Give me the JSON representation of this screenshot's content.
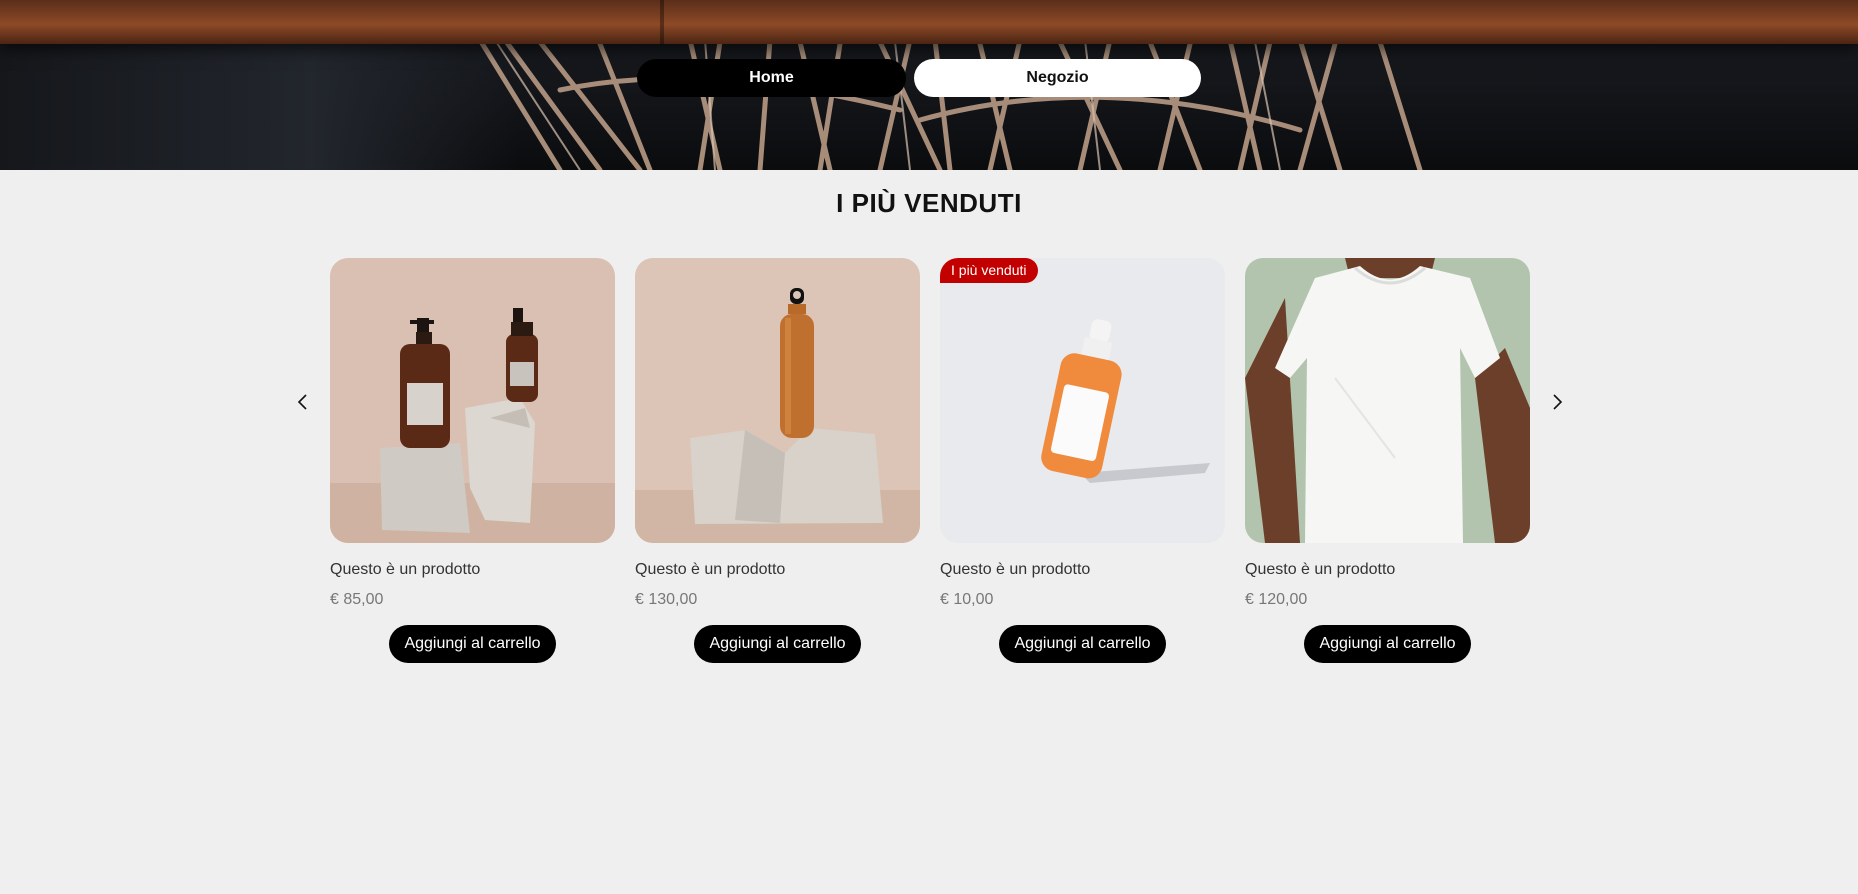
{
  "nav": {
    "home_label": "Home",
    "shop_label": "Negozio"
  },
  "section": {
    "title": "I PIÙ VENDUTI"
  },
  "carousel": {
    "prev_icon": "chevron-left-icon",
    "next_icon": "chevron-right-icon",
    "products": [
      {
        "name": "Questo è un prodotto",
        "price": "€ 85,00",
        "button": "Aggiungi al carrello",
        "badge": "",
        "image": "amber-pump-bottles-on-stone"
      },
      {
        "name": "Questo è un prodotto",
        "price": "€ 130,00",
        "button": "Aggiungi al carrello",
        "badge": "",
        "image": "copper-water-bottle-on-stone"
      },
      {
        "name": "Questo è un prodotto",
        "price": "€ 10,00",
        "button": "Aggiungi al carrello",
        "badge": "I più venduti",
        "image": "orange-dropper-bottle"
      },
      {
        "name": "Questo è un prodotto",
        "price": "€ 120,00",
        "button": "Aggiungi al carrello",
        "badge": "",
        "image": "white-t-shirt-model"
      }
    ]
  },
  "colors": {
    "background": "#efefef",
    "badge": "#c30000",
    "button": "#000000"
  }
}
